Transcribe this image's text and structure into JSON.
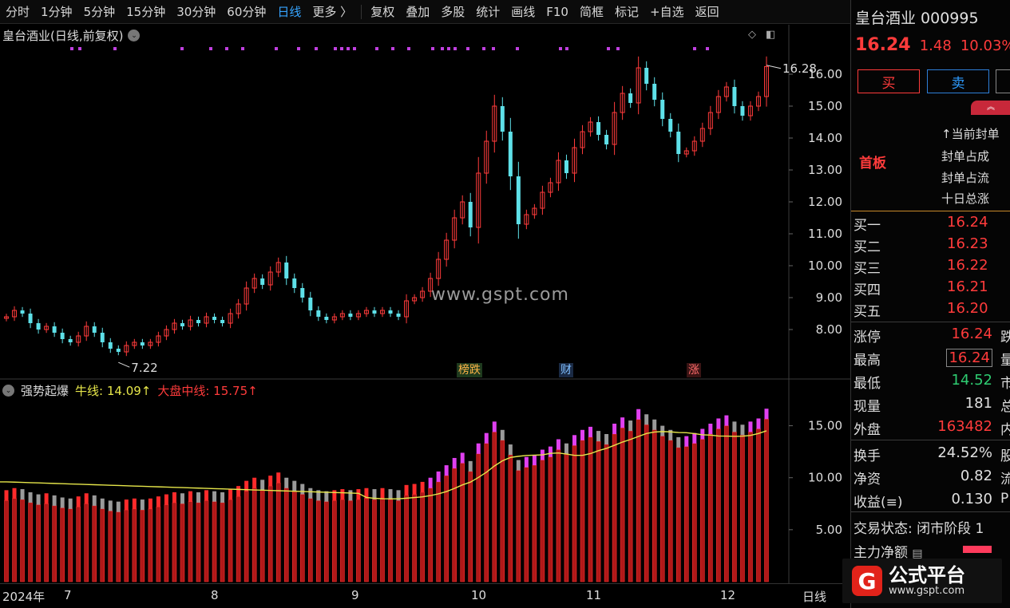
{
  "toolbar": {
    "items": [
      {
        "label": "分时",
        "active": false
      },
      {
        "label": "1分钟",
        "active": false
      },
      {
        "label": "5分钟",
        "active": false
      },
      {
        "label": "15分钟",
        "active": false
      },
      {
        "label": "30分钟",
        "active": false
      },
      {
        "label": "60分钟",
        "active": false
      },
      {
        "label": "日线",
        "active": true
      },
      {
        "label": "更多 〉",
        "active": false
      }
    ],
    "tools": [
      "复权",
      "叠加",
      "多股",
      "统计",
      "画线",
      "F10",
      "简框",
      "标记",
      "+自选",
      "返回"
    ]
  },
  "main_chart": {
    "title": "皇台酒业(日线,前复权)",
    "high_label": "16.28",
    "low_label": "7.22",
    "y_ticks": [
      "16.00",
      "15.00",
      "14.00",
      "13.00",
      "12.00",
      "11.00",
      "10.00",
      "9.00",
      "8.00"
    ]
  },
  "event_tags": [
    {
      "label": "榜跌",
      "color": "#ffb347",
      "bg": "#1e3a1e"
    },
    {
      "label": "财",
      "color": "#7fbfff",
      "bg": "#1a2a44"
    },
    {
      "label": "涨",
      "color": "#ff6b6b",
      "bg": "#3a1414"
    }
  ],
  "indicator": {
    "name": "强势起爆",
    "bull_label": "牛线: 14.09↑",
    "mid_label": "大盘中线: 15.75↑",
    "y_ticks": [
      "15.00",
      "10.00",
      "5.00"
    ]
  },
  "watermark": "www.gspt.com",
  "time_axis": {
    "labels": [
      "2024年",
      "7",
      "8",
      "9",
      "10",
      "11",
      "12"
    ],
    "mode": "日线"
  },
  "quote": {
    "name": "皇台酒业 000995",
    "price": "16.24",
    "change": "1.48",
    "pct": "10.03%",
    "buy": "买",
    "sell": "卖",
    "collapse": "︽",
    "first_board": "首板",
    "seal": [
      "↑当前封单",
      "封单占成",
      "封单占流",
      "十日总涨"
    ],
    "order_book": [
      {
        "label": "买一",
        "price": "16.24"
      },
      {
        "label": "买二",
        "price": "16.23"
      },
      {
        "label": "买三",
        "price": "16.22"
      },
      {
        "label": "买四",
        "price": "16.21"
      },
      {
        "label": "买五",
        "price": "16.20"
      }
    ],
    "stats": [
      {
        "label": "涨停",
        "value": "16.24",
        "color": "#ff3b3b",
        "cut": "跌"
      },
      {
        "label": "最高",
        "value": "16.24",
        "color": "#ff3b3b",
        "cut": "量"
      },
      {
        "label": "最低",
        "value": "14.52",
        "color": "#2ecc71",
        "cut": "市"
      },
      {
        "label": "现量",
        "value": "181",
        "color": "#e0e0e0",
        "cut": "总"
      },
      {
        "label": "外盘",
        "value": "163482",
        "color": "#ff3b3b",
        "cut": "内"
      },
      {
        "label": "换手",
        "value": "24.52%",
        "color": "#e0e0e0",
        "cut": "股"
      },
      {
        "label": "净资",
        "value": "0.82",
        "color": "#e0e0e0",
        "cut": "流"
      },
      {
        "label": "收益(≡)",
        "value": "0.130",
        "color": "#e0e0e0",
        "cut": "P"
      }
    ],
    "trade_status": "交易状态: 闭市阶段 1",
    "main_net": "主力净额"
  },
  "logo": {
    "cn": "公式平台",
    "url": "www.gspt.com"
  },
  "chart_data": {
    "type": "candlestick",
    "y_range": [
      7.0,
      16.5
    ],
    "highlighted": {
      "high": 16.28,
      "low": 7.22
    },
    "close_series": [
      8.4,
      8.6,
      8.5,
      8.2,
      8.0,
      8.1,
      7.9,
      7.7,
      7.6,
      7.8,
      8.1,
      7.9,
      7.6,
      7.4,
      7.3,
      7.5,
      7.6,
      7.5,
      7.6,
      7.8,
      8.0,
      8.2,
      8.1,
      8.3,
      8.2,
      8.4,
      8.3,
      8.2,
      8.5,
      8.8,
      9.3,
      9.6,
      9.4,
      9.8,
      10.1,
      9.6,
      9.3,
      9.0,
      8.6,
      8.4,
      8.3,
      8.4,
      8.5,
      8.4,
      8.5,
      8.6,
      8.5,
      8.6,
      8.5,
      8.4,
      8.9,
      9.0,
      9.2,
      9.6,
      10.2,
      10.8,
      11.5,
      12.0,
      11.2,
      12.9,
      13.9,
      15.0,
      14.2,
      12.8,
      11.3,
      11.6,
      11.8,
      12.3,
      12.6,
      13.3,
      12.9,
      13.7,
      14.2,
      14.5,
      14.1,
      13.8,
      14.8,
      15.4,
      15.1,
      16.2,
      15.7,
      15.2,
      14.6,
      14.2,
      13.5,
      13.6,
      13.9,
      14.3,
      14.8,
      15.3,
      15.6,
      15.0,
      14.7,
      15.0,
      15.3,
      16.24
    ]
  }
}
